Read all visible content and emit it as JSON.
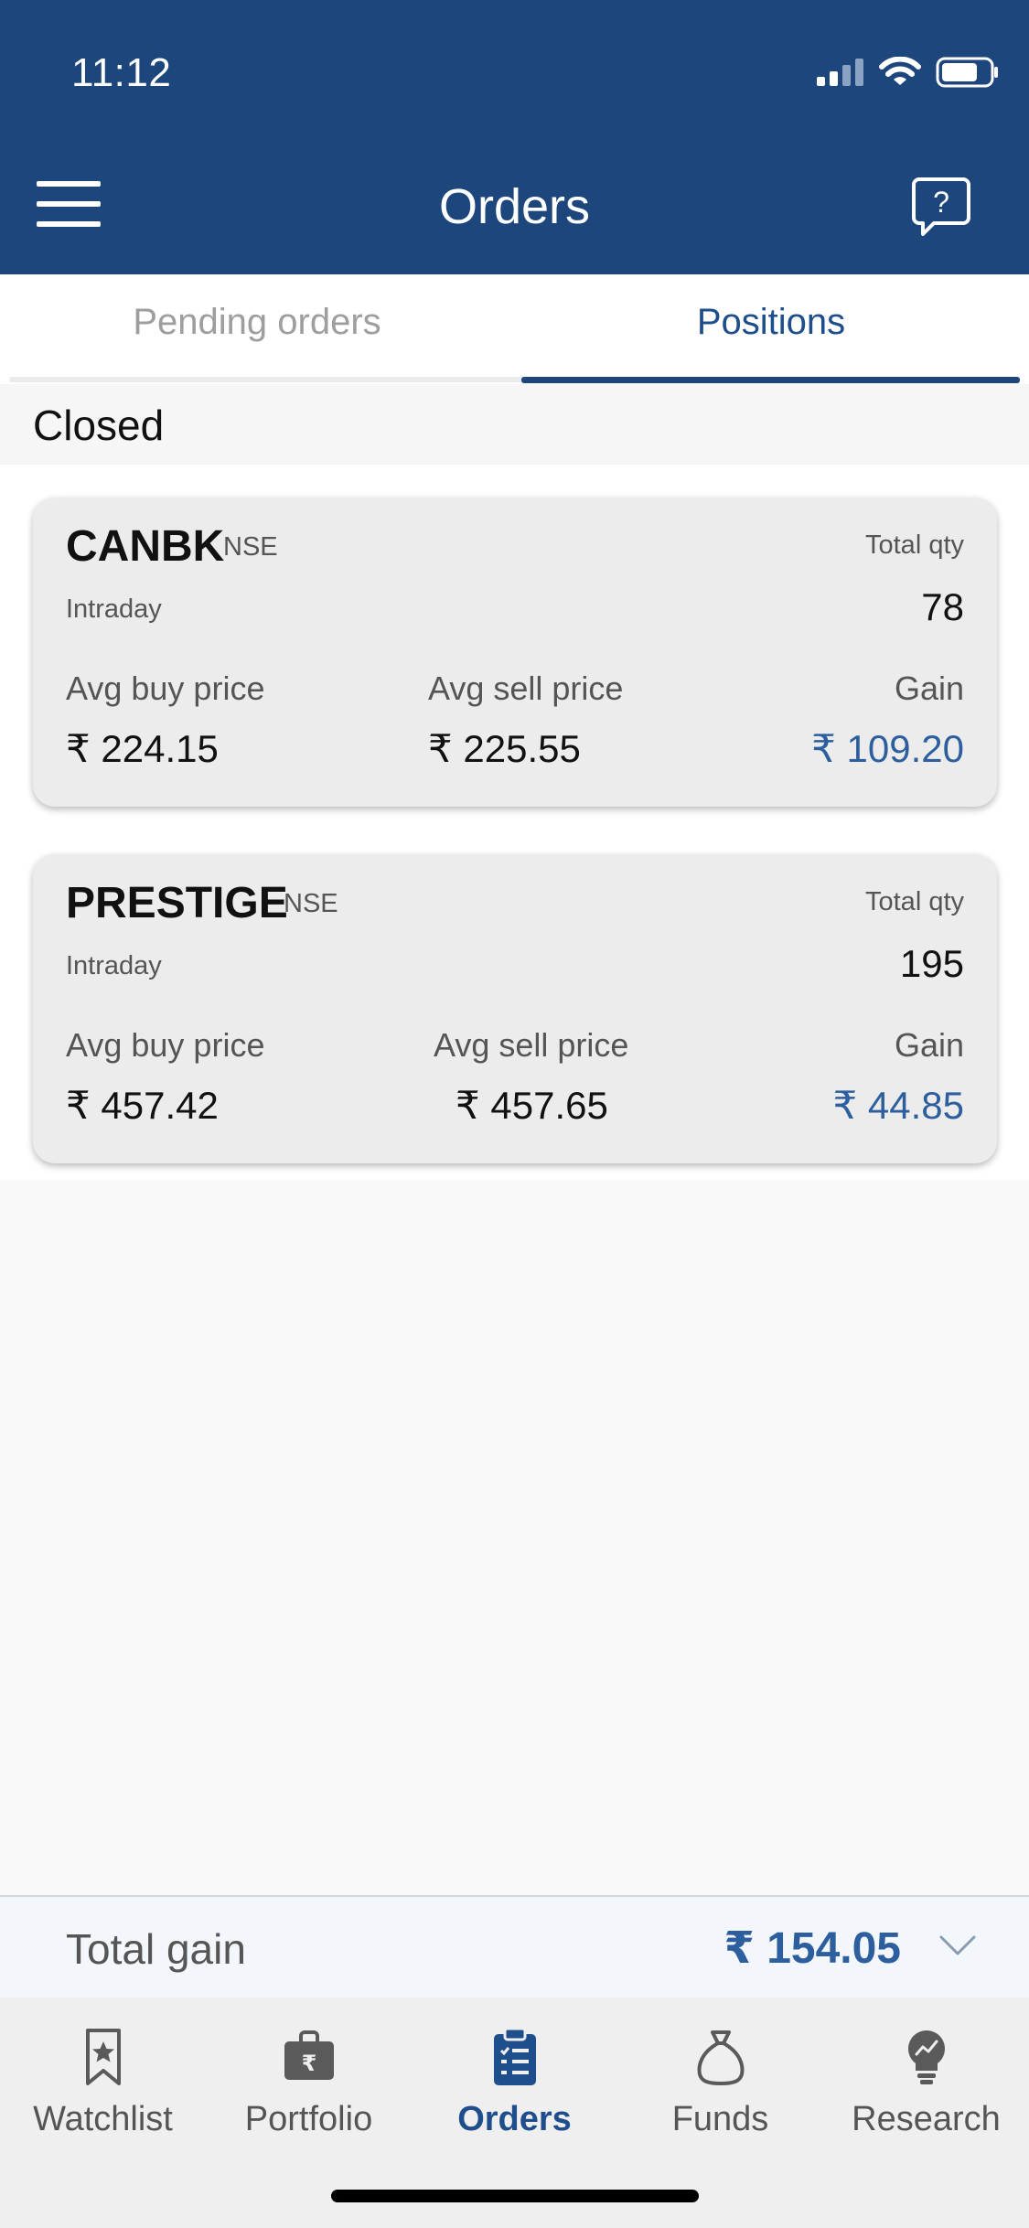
{
  "status_bar": {
    "time": "11:12"
  },
  "header": {
    "title": "Orders"
  },
  "tabs": [
    {
      "label": "Pending orders",
      "active": false
    },
    {
      "label": "Positions",
      "active": true
    }
  ],
  "section": {
    "title": "Closed"
  },
  "positions": [
    {
      "symbol": "CANBK",
      "exchange": "NSE",
      "product": "Intraday",
      "qty_label": "Total qty",
      "qty": "78",
      "avg_buy_label": "Avg buy price",
      "avg_buy": "₹ 224.15",
      "avg_sell_label": "Avg sell price",
      "avg_sell": "₹ 225.55",
      "gain_label": "Gain",
      "gain": "₹ 109.20"
    },
    {
      "symbol": "PRESTIGE",
      "exchange": "NSE",
      "product": "Intraday",
      "qty_label": "Total qty",
      "qty": "195",
      "avg_buy_label": "Avg buy price",
      "avg_buy": "₹ 457.42",
      "avg_sell_label": "Avg sell price",
      "avg_sell": "₹ 457.65",
      "gain_label": "Gain",
      "gain": "₹ 44.85"
    }
  ],
  "total": {
    "label": "Total gain",
    "value": "₹ 154.05"
  },
  "nav": [
    {
      "label": "Watchlist",
      "icon": "bookmark-star-icon",
      "active": false
    },
    {
      "label": "Portfolio",
      "icon": "briefcase-rupee-icon",
      "active": false
    },
    {
      "label": "Orders",
      "icon": "clipboard-list-icon",
      "active": true
    },
    {
      "label": "Funds",
      "icon": "money-bag-icon",
      "active": false
    },
    {
      "label": "Research",
      "icon": "lightbulb-chart-icon",
      "active": false
    }
  ],
  "colors": {
    "brand": "#1d467c",
    "accent": "#2d5f9e",
    "gain": "#2d5f9e"
  }
}
